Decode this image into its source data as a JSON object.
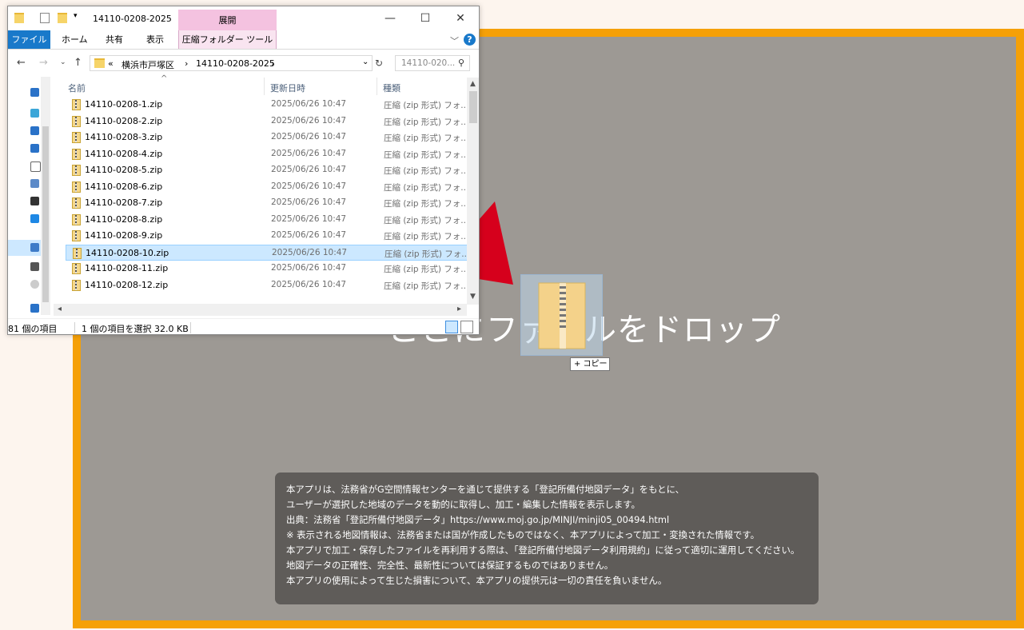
{
  "drop_zone": {
    "text": "ここにファイルをドロップ",
    "copy_tooltip": "+ コピー",
    "drag_icon": "zip-folder-icon"
  },
  "info": {
    "lines": [
      "本アプリは、法務省がG空間情報センターを通じて提供する「登記所備付地図データ」をもとに、",
      "ユーザーが選択した地域のデータを動的に取得し、加工・編集した情報を表示します。",
      "出典：法務省「登記所備付地図データ」https://www.moj.go.jp/MINJI/minji05_00494.html",
      "※ 表示される地図情報は、法務省または国が作成したものではなく、本アプリによって加工・変換された情報です。",
      "本アプリで加工・保存したファイルを再利用する際は、「登記所備付地図データ利用規約」に従って適切に運用してください。",
      "地図データの正確性、完全性、最新性については保証するものではありません。",
      "本アプリの使用によって生じた損害について、本アプリの提供元は一切の責任を負いません。"
    ]
  },
  "colors": {
    "frame": "#f5a007",
    "drop_bg": "#9d9994",
    "arrow": "#d6001c",
    "accent": "#1979ca"
  },
  "explorer": {
    "title": "14110-0208-2025",
    "context_tab": "展開",
    "ribbon_tabs": [
      "ファイル",
      "ホーム",
      "共有",
      "表示",
      "圧縮フォルダー ツール"
    ],
    "address": {
      "prefix": "«",
      "parts": [
        "横浜市戸塚区",
        "14110-0208-2025"
      ]
    },
    "search_placeholder": "14110-020...",
    "columns": {
      "name": "名前",
      "date": "更新日時",
      "type": "種類"
    },
    "files": [
      {
        "name": "14110-0208-1.zip",
        "date": "2025/06/26 10:47",
        "type": "圧縮 (zip 形式) フォ..."
      },
      {
        "name": "14110-0208-2.zip",
        "date": "2025/06/26 10:47",
        "type": "圧縮 (zip 形式) フォ..."
      },
      {
        "name": "14110-0208-3.zip",
        "date": "2025/06/26 10:47",
        "type": "圧縮 (zip 形式) フォ..."
      },
      {
        "name": "14110-0208-4.zip",
        "date": "2025/06/26 10:47",
        "type": "圧縮 (zip 形式) フォ..."
      },
      {
        "name": "14110-0208-5.zip",
        "date": "2025/06/26 10:47",
        "type": "圧縮 (zip 形式) フォ..."
      },
      {
        "name": "14110-0208-6.zip",
        "date": "2025/06/26 10:47",
        "type": "圧縮 (zip 形式) フォ..."
      },
      {
        "name": "14110-0208-7.zip",
        "date": "2025/06/26 10:47",
        "type": "圧縮 (zip 形式) フォ..."
      },
      {
        "name": "14110-0208-8.zip",
        "date": "2025/06/26 10:47",
        "type": "圧縮 (zip 形式) フォ..."
      },
      {
        "name": "14110-0208-9.zip",
        "date": "2025/06/26 10:47",
        "type": "圧縮 (zip 形式) フォ..."
      },
      {
        "name": "14110-0208-10.zip",
        "date": "2025/06/26 10:47",
        "type": "圧縮 (zip 形式) フォ..."
      },
      {
        "name": "14110-0208-11.zip",
        "date": "2025/06/26 10:47",
        "type": "圧縮 (zip 形式) フォ..."
      },
      {
        "name": "14110-0208-12.zip",
        "date": "2025/06/26 10:47",
        "type": "圧縮 (zip 形式) フォ..."
      }
    ],
    "selected_index": 9,
    "status": {
      "count": "81 個の項目",
      "selection": "1 個の項目を選択 32.0 KB"
    }
  }
}
